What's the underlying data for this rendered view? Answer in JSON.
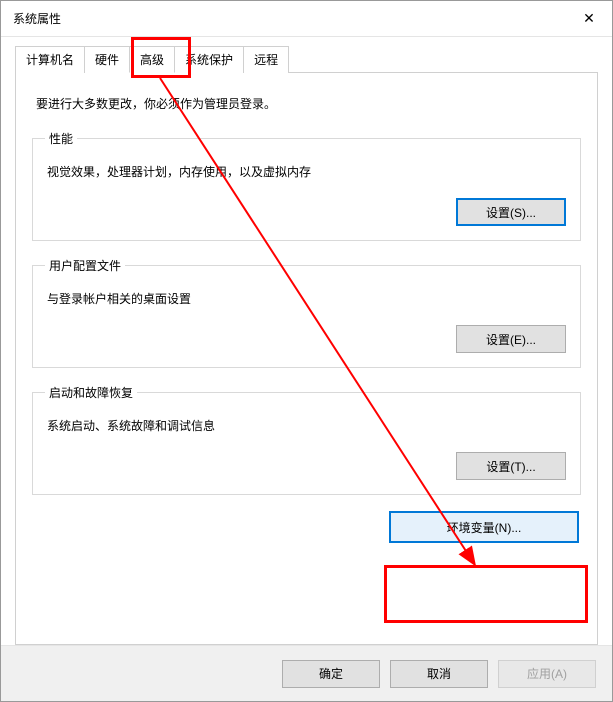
{
  "window": {
    "title": "系统属性",
    "close_icon": "✕"
  },
  "tabs": {
    "computer_name": "计算机名",
    "hardware": "硬件",
    "advanced": "高级",
    "system_protection": "系统保护",
    "remote": "远程"
  },
  "panel": {
    "intro": "要进行大多数更改，你必须作为管理员登录。",
    "performance": {
      "legend": "性能",
      "desc": "视觉效果，处理器计划，内存使用，以及虚拟内存",
      "settings_label": "设置(S)..."
    },
    "user_profiles": {
      "legend": "用户配置文件",
      "desc": "与登录帐户相关的桌面设置",
      "settings_label": "设置(E)..."
    },
    "startup_recovery": {
      "legend": "启动和故障恢复",
      "desc": "系统启动、系统故障和调试信息",
      "settings_label": "设置(T)..."
    },
    "env_vars_label": "环境变量(N)..."
  },
  "footer": {
    "ok": "确定",
    "cancel": "取消",
    "apply": "应用(A)"
  }
}
